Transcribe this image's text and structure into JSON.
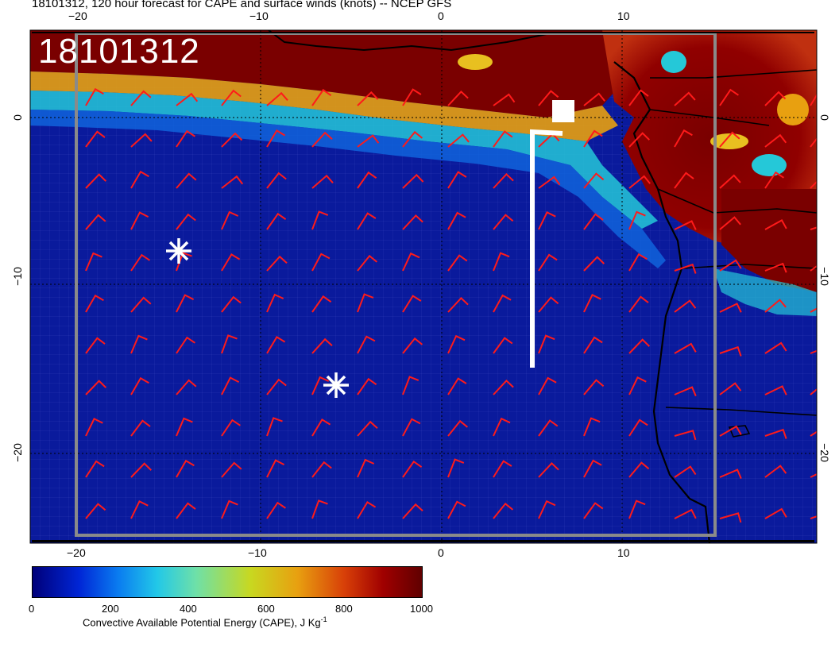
{
  "title": "18101312, 120 hour forecast for CAPE and surface winds (knots) -- NCEP GFS",
  "date_label": "18101312",
  "axes": {
    "top_ticks": [
      "−20",
      "−10",
      "0",
      "10"
    ],
    "bottom_ticks": [
      "−20",
      "−10",
      "0",
      "10"
    ],
    "left_ticks": [
      "0",
      "−10",
      "−20"
    ],
    "right_ticks": [
      "0",
      "−10",
      "−20"
    ]
  },
  "colorbar": {
    "ticks": [
      "0",
      "200",
      "400",
      "600",
      "800",
      "1000"
    ],
    "label_main": "Convective Available Potential Energy (CAPE), J Kg",
    "label_sup": "-1",
    "colors": [
      "#00007a",
      "#0026d6",
      "#0a7cf0",
      "#22c8e8",
      "#6ee0a8",
      "#c8d820",
      "#e8a010",
      "#d84008",
      "#a00000",
      "#600000"
    ]
  },
  "colors": {
    "ocean": "#0a1a9c",
    "land_high": "#7a0000",
    "wind_barb": "#ff1a1a",
    "markers": "#ffffff"
  },
  "markers": [
    {
      "type": "asterisk",
      "lon": -14.5,
      "lat": -8
    },
    {
      "type": "asterisk",
      "lon": -6,
      "lat": -16
    }
  ],
  "track": {
    "lons": [
      7,
      5,
      5
    ],
    "lats": [
      0,
      -1,
      -15
    ],
    "end": "square"
  }
}
